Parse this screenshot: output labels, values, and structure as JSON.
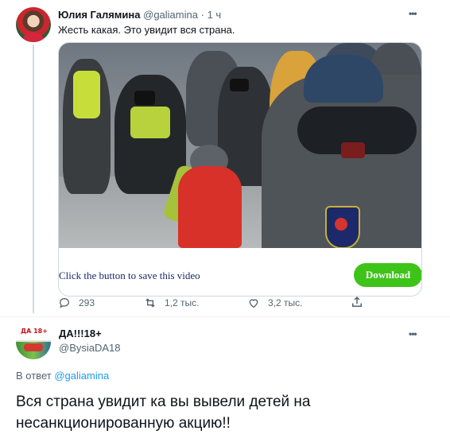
{
  "tweet1": {
    "name": "Юлия Галямина",
    "handle": "@galiamina",
    "separator": "·",
    "time": "1 ч",
    "text": "Жесть какая. Это увидит вся страна.",
    "more_icon": "more-horizontal-icon",
    "media": {
      "save_text": "Click the button to save this video",
      "download_label": "Download",
      "download_color": "#3ec419"
    },
    "actions": {
      "replies": "293",
      "retweets": "1,2 тыс.",
      "likes": "3,2 тыс.",
      "reply_icon": "reply-icon",
      "retweet_icon": "retweet-icon",
      "like_icon": "heart-icon",
      "share_icon": "share-icon"
    }
  },
  "tweet2": {
    "name": "ДА!!!18+",
    "handle": "@BysiaDA18",
    "more_icon": "more-horizontal-icon",
    "reply_prefix": "В ответ",
    "reply_to": "@galiamina",
    "text": "Вся страна увидит ка вы вывели детей на несанкционированную акцию!!",
    "avatar_text": "ДА 18+"
  },
  "colors": {
    "accent": "#1d9bf0",
    "secondary_text": "#536471",
    "primary_text": "#0f1419",
    "border": "#cfd9de"
  }
}
